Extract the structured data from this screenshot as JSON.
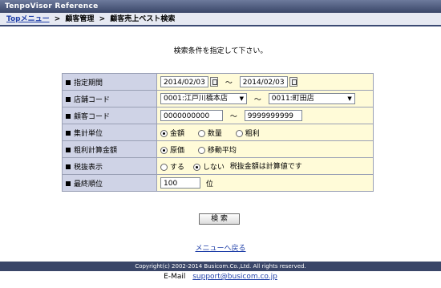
{
  "app_title": "TenpoVisor Reference",
  "breadcrumb": {
    "items": [
      "Topメニュー",
      "顧客管理",
      "顧客売上ベスト検索"
    ],
    "separator": ">"
  },
  "instruction": "検索条件を指定して下さい。",
  "form": {
    "period": {
      "label": "指定期間",
      "from": "2014/02/03",
      "to": "2014/02/03",
      "range_sep": "～"
    },
    "store": {
      "label": "店舗コード",
      "from": "0001:江戸川橋本店",
      "to": "0011:町田店",
      "range_sep": "～"
    },
    "customer": {
      "label": "顧客コード",
      "from": "0000000000",
      "to": "9999999999",
      "range_sep": "～"
    },
    "unit": {
      "label": "集計単位",
      "options": [
        "金額",
        "数量",
        "粗利"
      ],
      "selected": "金額"
    },
    "profit_calc": {
      "label": "粗利計算金額",
      "options": [
        "原価",
        "移動平均"
      ],
      "selected": "原価"
    },
    "tax_display": {
      "label": "税抜表示",
      "options": [
        "する",
        "しない"
      ],
      "selected": "しない",
      "note": "税抜金額は計算値です"
    },
    "last_rank": {
      "label": "最終順位",
      "value": "100",
      "unit": "位"
    }
  },
  "search_button": "検 索",
  "back_link": "メニューへ戻る",
  "footer": {
    "copyright": "Copyright(c) 2002-2014 Busicom.Co.,Ltd. All rights reserved.",
    "email_label": "E-Mail",
    "email": "support@busicom.co.jp"
  },
  "colors": {
    "title_bar": "#3a4668",
    "label_cell": "#cfd3e6",
    "value_cell": "#fffbd8",
    "link": "#1f3fa8"
  }
}
